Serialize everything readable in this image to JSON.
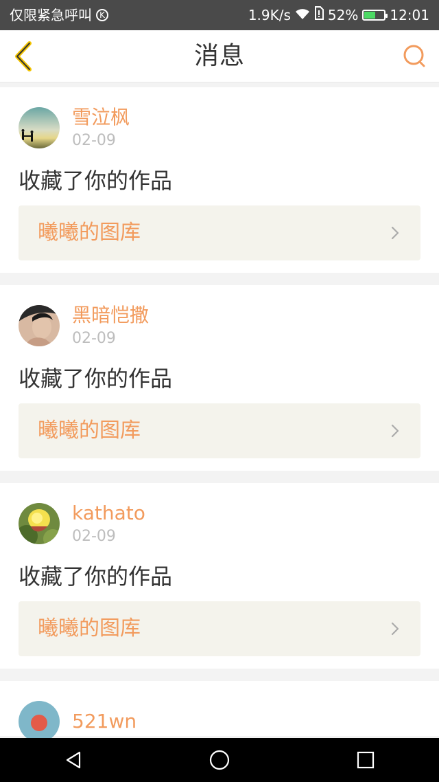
{
  "status_bar": {
    "left_text": "仅限紧急呼叫",
    "k_icon_text": "K",
    "speed": "1.9K/s",
    "battery_text": "52%",
    "time": "12:01"
  },
  "header": {
    "title": "消息"
  },
  "messages": [
    {
      "username": "雪泣枫",
      "date": "02-09",
      "action": "收藏了你的作品",
      "gallery": "曦曦的图库"
    },
    {
      "username": "黑暗恺撒",
      "date": "02-09",
      "action": "收藏了你的作品",
      "gallery": "曦曦的图库"
    },
    {
      "username": "kathato",
      "date": "02-09",
      "action": "收藏了你的作品",
      "gallery": "曦曦的图库"
    },
    {
      "username": "521wn"
    }
  ],
  "colors": {
    "accent": "#f29b5d",
    "date": "#bdbdbd",
    "text": "#333333",
    "card_bg": "#ffffff",
    "gallery_bg": "#f4f3ec",
    "status_bar_bg": "#4a4a4a",
    "nav_bar_bg": "#000000"
  },
  "icons": {
    "back": "back-icon",
    "search": "search-icon",
    "chevron": "chevron-right-icon",
    "wifi": "wifi-icon",
    "sim": "sim-icon",
    "battery": "battery-icon",
    "nav_back": "nav-back-icon",
    "nav_home": "nav-home-icon",
    "nav_recent": "nav-recent-icon"
  },
  "battery_level_percent": 52
}
